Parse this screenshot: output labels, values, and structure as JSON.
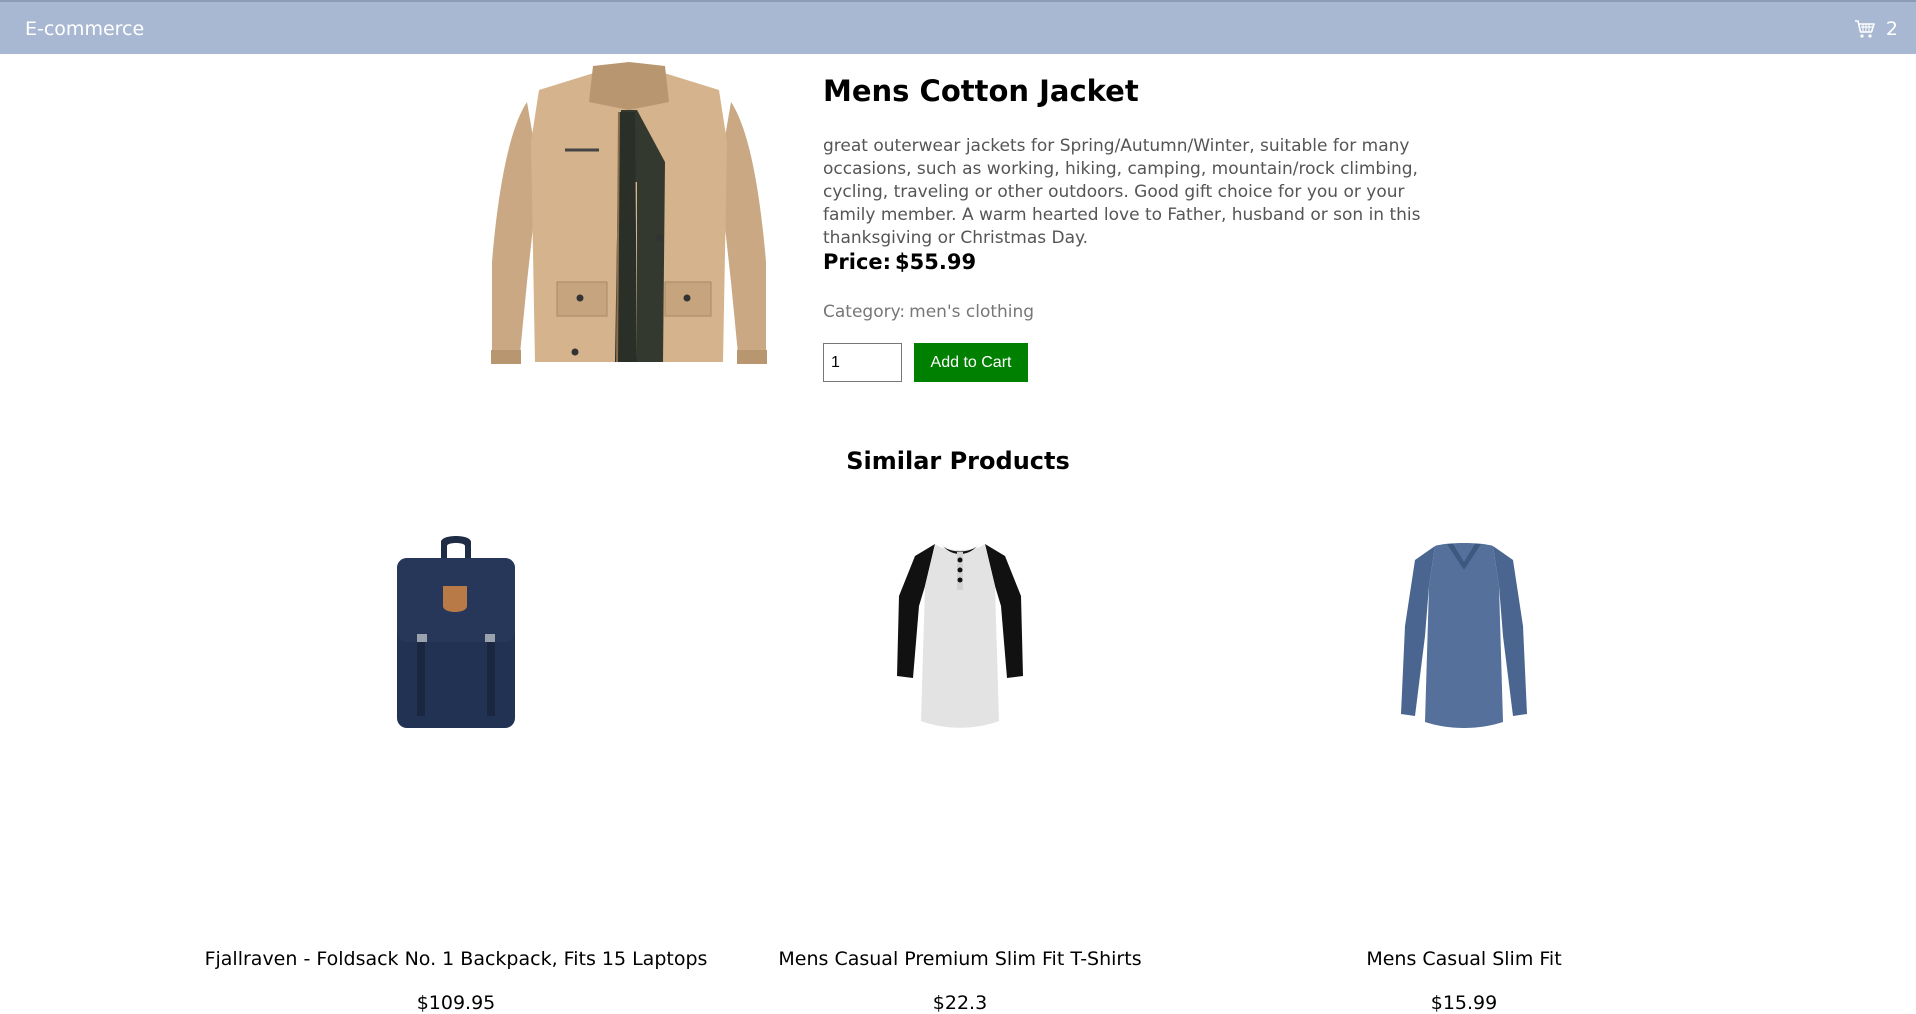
{
  "header": {
    "brand": "E-commerce",
    "cart_icon": "shopping-cart-icon",
    "cart_count": "2",
    "background": "#a9b8d2"
  },
  "product": {
    "title": "Mens Cotton Jacket",
    "description": "great outerwear jackets for Spring/Autumn/Winter, suitable for many occasions, such as working, hiking, camping, mountain/rock climbing, cycling, traveling or other outdoors. Good gift choice for you or your family member. A warm hearted love to Father, husband or son in this thanksgiving or Christmas Day.",
    "price_label": "Price:",
    "price_value": "$55.99",
    "category_label": "Category:",
    "category_value": "men's clothing",
    "quantity": "1",
    "add_to_cart_label": "Add to Cart",
    "add_to_cart_color": "#008000"
  },
  "similar": {
    "heading": "Similar Products",
    "items": [
      {
        "name": "Fjallraven - Foldsack No. 1 Backpack, Fits 15 Laptops",
        "price": "$109.95"
      },
      {
        "name": "Mens Casual Premium Slim Fit T-Shirts",
        "price": "$22.3"
      },
      {
        "name": "Mens Casual Slim Fit",
        "price": "$15.99"
      }
    ]
  }
}
